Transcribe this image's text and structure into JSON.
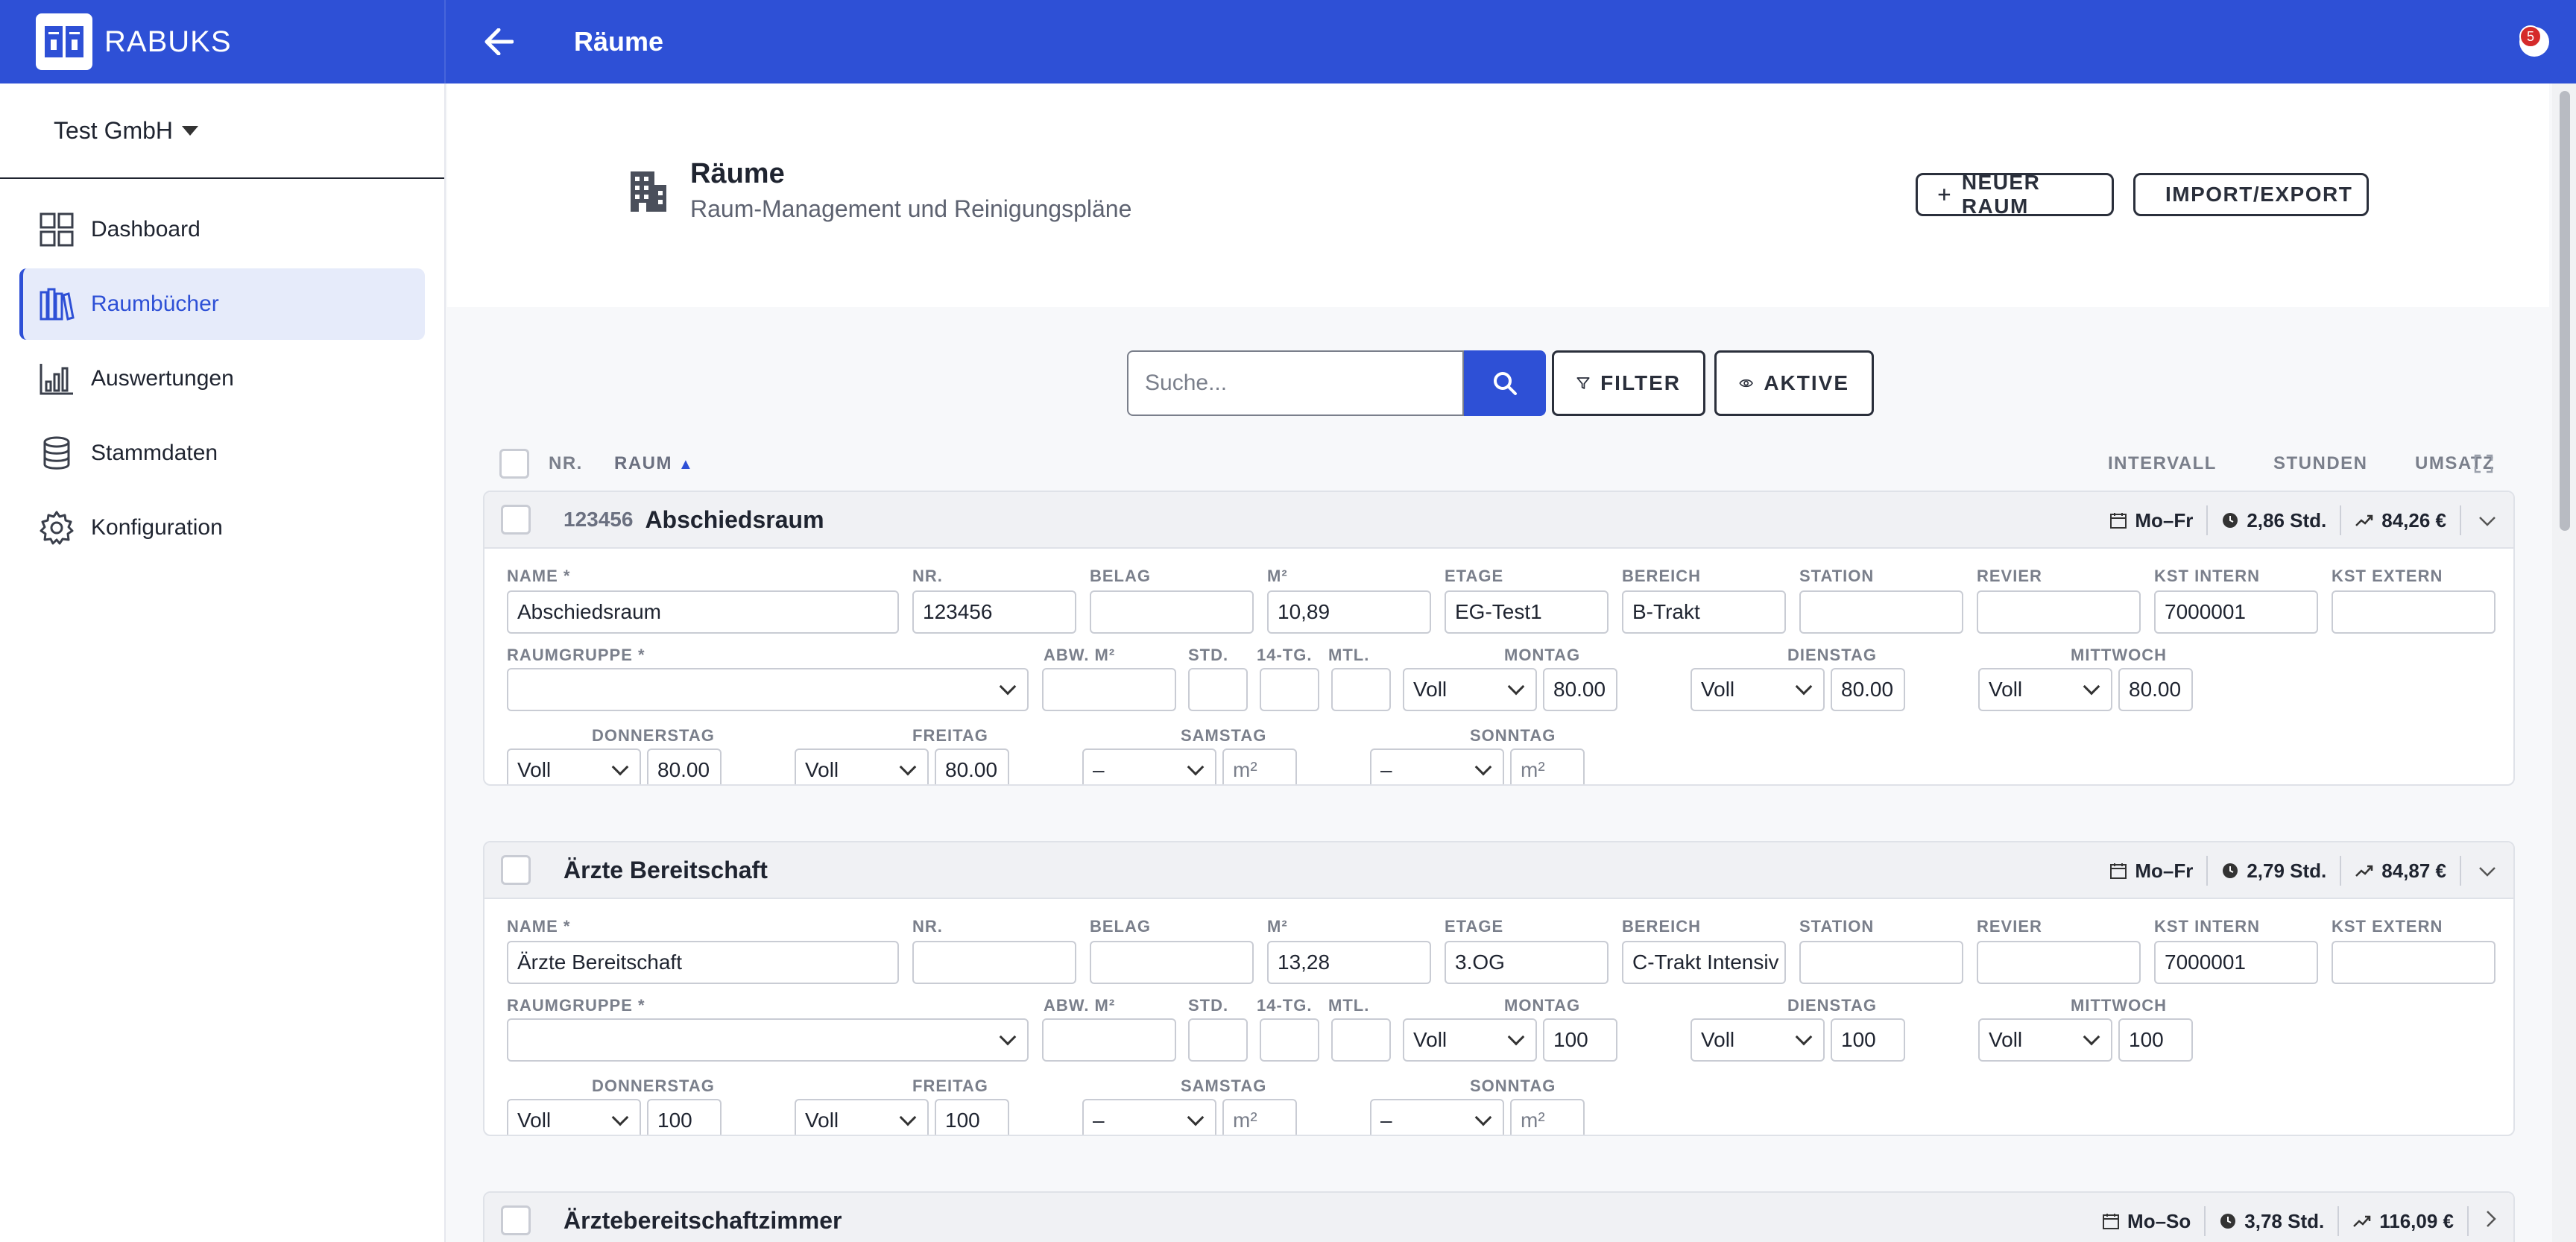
{
  "app": {
    "name": "RABUKS",
    "page_title": "Räume",
    "notification_count": "5"
  },
  "sidebar": {
    "company": "Test GmbH",
    "items": [
      {
        "label": "Dashboard",
        "icon": "dashboard-icon"
      },
      {
        "label": "Raumbücher",
        "icon": "books-icon"
      },
      {
        "label": "Auswertungen",
        "icon": "chart-icon"
      },
      {
        "label": "Stammdaten",
        "icon": "database-icon"
      },
      {
        "label": "Konfiguration",
        "icon": "gear-icon"
      }
    ],
    "active_index": 1
  },
  "header": {
    "title": "Räume",
    "subtitle": "Raum-Management und Reinigungspläne",
    "new_button": "NEUER RAUM",
    "import_button": "IMPORT/EXPORT"
  },
  "toolbar": {
    "search_placeholder": "Suche...",
    "filter_label": "FILTER",
    "aktive_label": "AKTIVE"
  },
  "list_header": {
    "nr": "NR.",
    "raum": "RAUM",
    "intervall": "INTERVALL",
    "stunden": "STUNDEN",
    "umsatz": "UMSATZ"
  },
  "labels": {
    "name": "NAME *",
    "nr": "NR.",
    "belag": "BELAG",
    "m2": "M²",
    "etage": "ETAGE",
    "bereich": "BEREICH",
    "station": "STATION",
    "revier": "REVIER",
    "kst_intern": "KST INTERN",
    "kst_extern": "KST EXTERN",
    "raumgruppe": "RAUMGRUPPE *",
    "abw_m2": "ABW. M²",
    "std": "STD.",
    "tg14": "14-TG.",
    "mtl": "MTL.",
    "montag": "MONTAG",
    "dienstag": "DIENSTAG",
    "mittwoch": "MITTWOCH",
    "donnerstag": "DONNERSTAG",
    "freitag": "FREITAG",
    "samstag": "SAMSTAG",
    "sonntag": "SONNTAG",
    "m2_placeholder": "m²"
  },
  "rooms": [
    {
      "nr": "123456",
      "name": "Abschiedsraum",
      "intervall": "Mo–Fr",
      "stunden": "2,86 Std.",
      "umsatz": "84,26 €",
      "fields": {
        "name": "Abschiedsraum",
        "nr": "123456",
        "belag": "",
        "m2": "10,89",
        "etage": "EG-Test1",
        "bereich": "B-Trakt",
        "station": "",
        "revier": "",
        "kst_intern": "7000001",
        "kst_extern": "",
        "raumgruppe": "",
        "abw_m2": "",
        "std": "",
        "tg14": "",
        "mtl": "",
        "montag_sel": "Voll",
        "montag_val": "80.00",
        "dienstag_sel": "Voll",
        "dienstag_val": "80.00",
        "mittwoch_sel": "Voll",
        "mittwoch_val": "80.00",
        "donnerstag_sel": "Voll",
        "donnerstag_val": "80.00",
        "freitag_sel": "Voll",
        "freitag_val": "80.00",
        "samstag_sel": "–",
        "samstag_val": "",
        "sonntag_sel": "–",
        "sonntag_val": ""
      }
    },
    {
      "nr": "",
      "name": "Ärzte Bereitschaft",
      "intervall": "Mo–Fr",
      "stunden": "2,79 Std.",
      "umsatz": "84,87 €",
      "fields": {
        "name": "Ärzte Bereitschaft",
        "nr": "",
        "belag": "",
        "m2": "13,28",
        "etage": "3.OG",
        "bereich": "C-Trakt Intensiv",
        "station": "",
        "revier": "",
        "kst_intern": "7000001",
        "kst_extern": "",
        "raumgruppe": "",
        "abw_m2": "",
        "std": "",
        "tg14": "",
        "mtl": "",
        "montag_sel": "Voll",
        "montag_val": "100",
        "dienstag_sel": "Voll",
        "dienstag_val": "100",
        "mittwoch_sel": "Voll",
        "mittwoch_val": "100",
        "donnerstag_sel": "Voll",
        "donnerstag_val": "100",
        "freitag_sel": "Voll",
        "freitag_val": "100",
        "samstag_sel": "–",
        "samstag_val": "",
        "sonntag_sel": "–",
        "sonntag_val": ""
      }
    },
    {
      "nr": "",
      "name": "Ärztebereitschaftzimmer",
      "intervall": "Mo–So",
      "stunden": "3,78 Std.",
      "umsatz": "116,09 €"
    }
  ],
  "colors": {
    "primary": "#2e50d6",
    "active_bg": "#e6ebfa",
    "badge": "#d52a2a"
  }
}
